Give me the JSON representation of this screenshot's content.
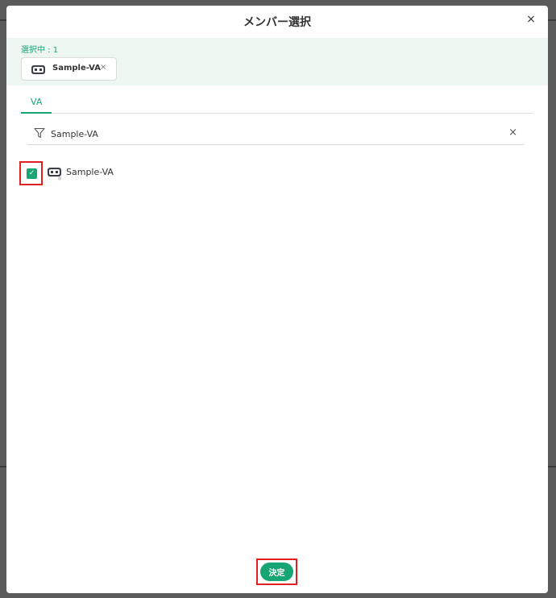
{
  "modal": {
    "title": "メンバー選択",
    "close_label": "×"
  },
  "selected": {
    "count_label": "選択中 : 1",
    "chips": [
      {
        "label": "Sample-VA",
        "remove_label": "×",
        "icon": "robot-icon"
      }
    ]
  },
  "tabs": [
    {
      "label": "VA",
      "active": true
    }
  ],
  "search": {
    "value": "Sample-VA",
    "placeholder": "",
    "clear_label": "×"
  },
  "members": [
    {
      "label": "Sample-VA",
      "checked": true,
      "check_mark": "✓",
      "icon": "robot-icon"
    }
  ],
  "footer": {
    "confirm_label": "決定"
  },
  "colors": {
    "accent": "#17a673",
    "selected_bg": "#eef6f1",
    "highlight": "#e02020"
  }
}
